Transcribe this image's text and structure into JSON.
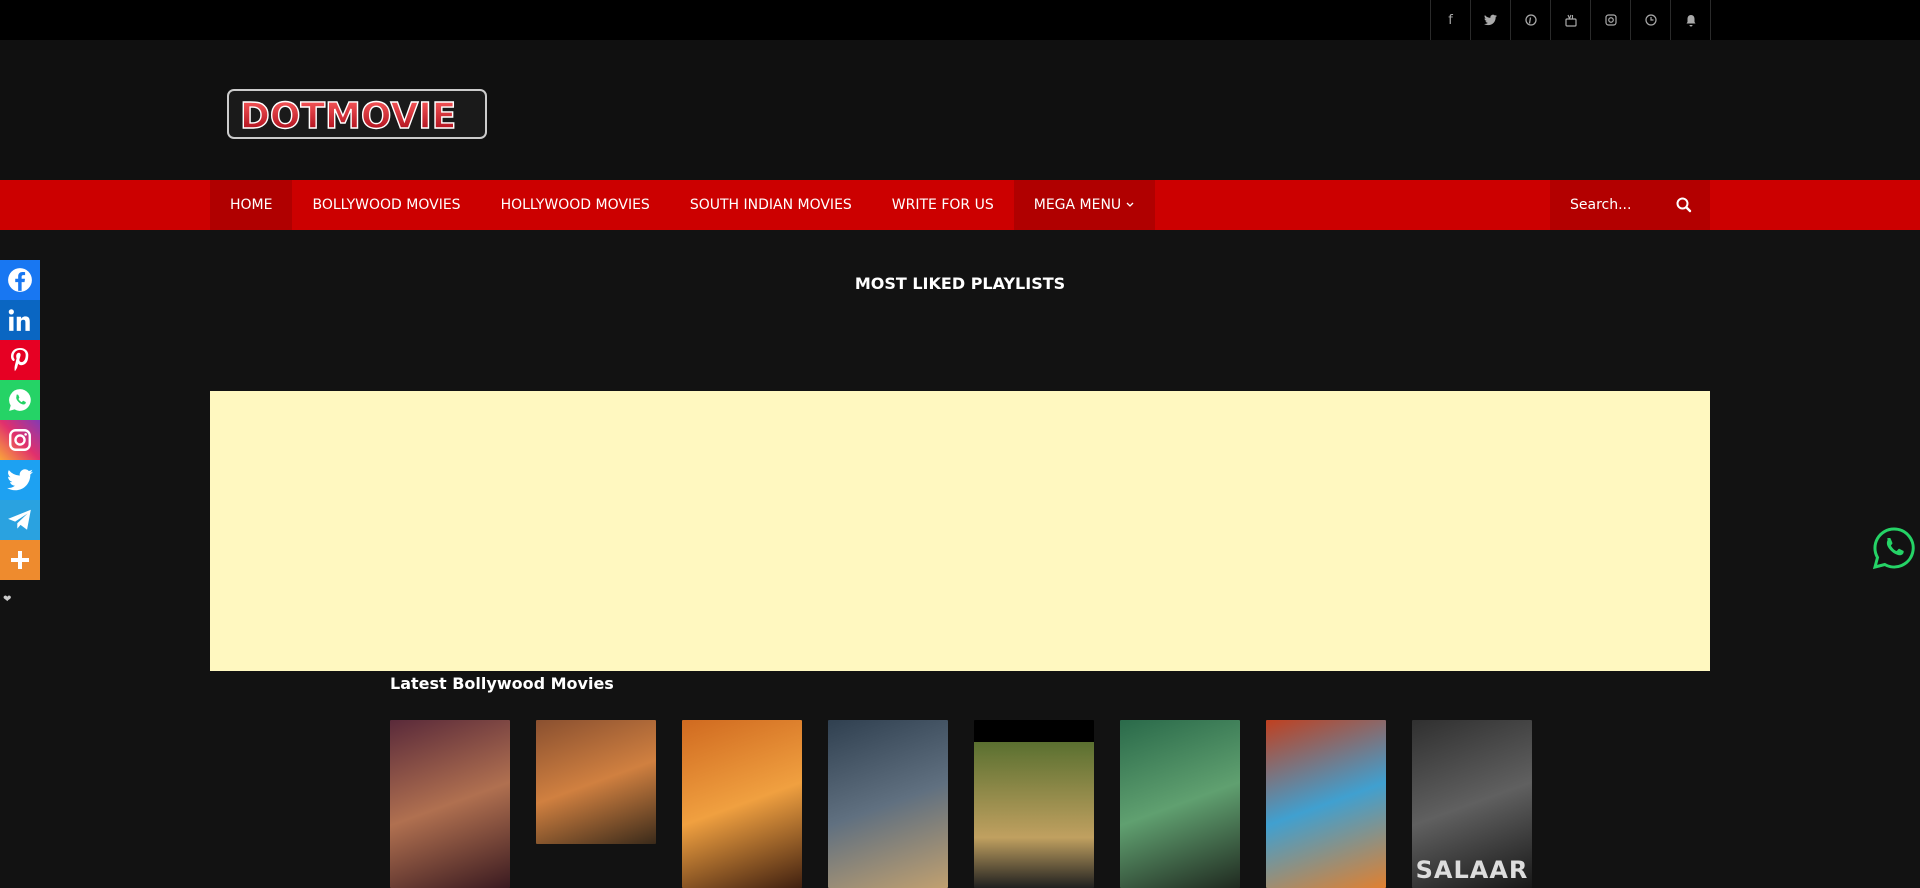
{
  "topbar": {
    "social_icons": [
      "facebook-icon",
      "twitter-icon",
      "pinterest-icon",
      "youtube-icon",
      "instagram-icon",
      "clock-icon",
      "bell-icon"
    ]
  },
  "logo": {
    "text": "DOTMOVIE"
  },
  "nav": {
    "items": [
      {
        "label": "HOME"
      },
      {
        "label": "BOLLYWOOD MOVIES"
      },
      {
        "label": "HOLLYWOOD MOVIES"
      },
      {
        "label": "SOUTH INDIAN MOVIES"
      },
      {
        "label": "WRITE FOR US"
      },
      {
        "label": "MEGA MENU"
      }
    ],
    "search_placeholder": "Search..."
  },
  "main": {
    "section_title": "MOST LIKED PLAYLISTS",
    "latest_title": "Latest Bollywood Movies",
    "movies": [
      {
        "caption": "",
        "colors": [
          "#5a2a3a",
          "#b07050",
          "#3a1a20"
        ]
      },
      {
        "caption": "",
        "colors": [
          "#8a5030",
          "#d08040",
          "#3a2a1a"
        ]
      },
      {
        "caption": "",
        "colors": [
          "#d06a20",
          "#f0a040",
          "#402010"
        ]
      },
      {
        "caption": "",
        "colors": [
          "#304050",
          "#607080",
          "#c0a070"
        ]
      },
      {
        "caption": "",
        "colors": [
          "#5a7030",
          "#c0a060",
          "#202020"
        ]
      },
      {
        "caption": "",
        "colors": [
          "#2a6a4a",
          "#60a070",
          "#202a20"
        ]
      },
      {
        "caption": "",
        "colors": [
          "#c04020",
          "#40a0d0",
          "#e08030"
        ]
      },
      {
        "caption": "SALAAR",
        "colors": [
          "#303030",
          "#606060",
          "#181818"
        ]
      }
    ]
  },
  "share_bar": {
    "items": [
      {
        "name": "facebook",
        "color": "#1877f2"
      },
      {
        "name": "linkedin",
        "color": "#0a66c2"
      },
      {
        "name": "pinterest",
        "color": "#e60023"
      },
      {
        "name": "whatsapp",
        "color": "#25d366"
      },
      {
        "name": "instagram",
        "color": "#e1306c"
      },
      {
        "name": "twitter",
        "color": "#1da1f2"
      },
      {
        "name": "telegram",
        "color": "#2aa2e0"
      },
      {
        "name": "more",
        "color": "#ee8b2e"
      }
    ]
  },
  "colors": {
    "nav_bg": "#cc0000",
    "ad_bg": "#fff8c0",
    "body_bg": "#121212",
    "whatsapp_green": "#25d366"
  }
}
